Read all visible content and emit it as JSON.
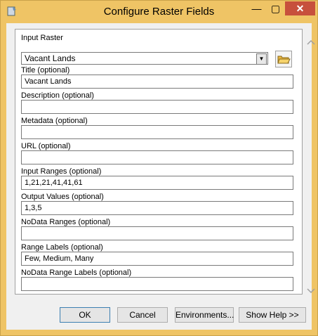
{
  "window": {
    "title": "Configure Raster Fields",
    "min_glyph": "—",
    "max_glyph": "▢",
    "close_glyph": "✕"
  },
  "form": {
    "input_raster": {
      "label": "Input Raster",
      "value": "Vacant Lands"
    },
    "title": {
      "label": "Title (optional)",
      "value": "Vacant Lands"
    },
    "description": {
      "label": "Description (optional)",
      "value": ""
    },
    "metadata": {
      "label": "Metadata (optional)",
      "value": ""
    },
    "url": {
      "label": "URL (optional)",
      "value": ""
    },
    "input_ranges": {
      "label": "Input Ranges (optional)",
      "value": "1,21,21,41,41,61"
    },
    "output_values": {
      "label": "Output Values (optional)",
      "value": "1,3,5"
    },
    "nodata_ranges": {
      "label": "NoData Ranges (optional)",
      "value": ""
    },
    "range_labels": {
      "label": "Range Labels (optional)",
      "value": "Few, Medium, Many"
    },
    "nodata_range_labels": {
      "label": "NoData Range Labels (optional)",
      "value": ""
    }
  },
  "buttons": {
    "ok": "OK",
    "cancel": "Cancel",
    "environments": "Environments...",
    "show_help": "Show Help >>"
  },
  "icons": {
    "scroll_up": "scroll-up-icon",
    "scroll_down": "scroll-down-icon",
    "folder": "folder-open-icon",
    "app": "app-icon"
  },
  "colors": {
    "title_bar": "#efc465",
    "close": "#c7503c",
    "panel": "#f0f0f0"
  }
}
